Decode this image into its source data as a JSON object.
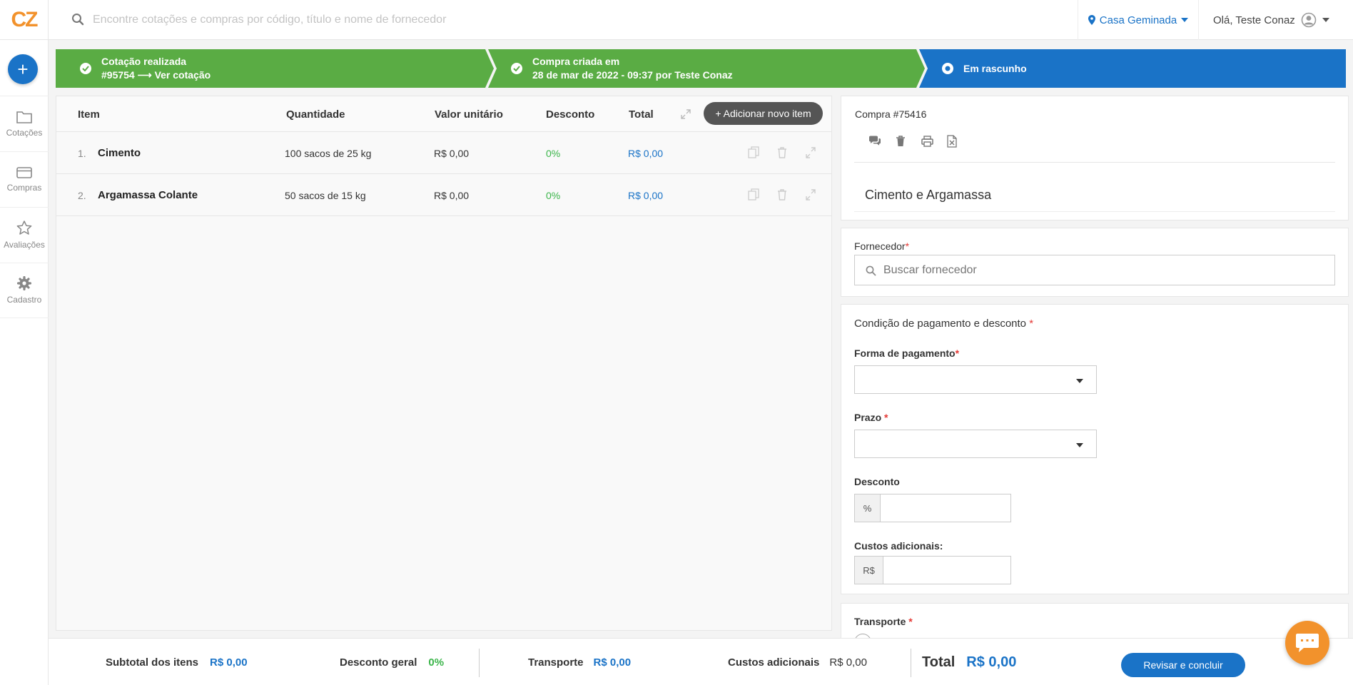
{
  "header": {
    "logo": "CZ",
    "search_placeholder": "Encontre cotações e compras por código, título e nome de fornecedor",
    "location": "Casa Geminada",
    "greeting": "Olá, Teste Conaz"
  },
  "sidebar": {
    "items": [
      {
        "label": "Cotações",
        "icon": "folder-icon"
      },
      {
        "label": "Compras",
        "icon": "card-icon"
      },
      {
        "label": "Avaliações",
        "icon": "star-icon"
      },
      {
        "label": "Cadastro",
        "icon": "gear-icon"
      }
    ]
  },
  "steps": {
    "s1_line1": "Cotação realizada",
    "s1_line2": "#95754 ⟶ Ver cotação",
    "s2_line1": "Compra criada em",
    "s2_line2": "28 de mar de 2022 - 09:37 por Teste Conaz",
    "s3": "Em rascunho"
  },
  "table": {
    "headers": {
      "item": "Item",
      "quantidade": "Quantidade",
      "valor": "Valor unitário",
      "desconto": "Desconto",
      "total": "Total"
    },
    "add_button": "+ Adicionar novo item",
    "rows": [
      {
        "idx": "1.",
        "name": "Cimento",
        "qty": "100 sacos de 25 kg",
        "price": "R$ 0,00",
        "discount": "0%",
        "total": "R$ 0,00"
      },
      {
        "idx": "2.",
        "name": "Argamassa Colante",
        "qty": "50 sacos de 15 kg",
        "price": "R$ 0,00",
        "discount": "0%",
        "total": "R$ 0,00"
      }
    ]
  },
  "purchase": {
    "code": "Compra #75416",
    "title": "Cimento e Argamassa"
  },
  "supplier": {
    "label": "Fornecedor",
    "required": "*",
    "placeholder": "Buscar fornecedor"
  },
  "payment": {
    "section_label": "Condição de pagamento e desconto",
    "required": "*",
    "method_label": "Forma de pagamento",
    "term_label": "Prazo",
    "discount_label": "Desconto",
    "discount_addon": "%",
    "costs_label": "Custos adicionais:",
    "costs_addon": "R$"
  },
  "transport": {
    "label": "Transporte",
    "required": "*"
  },
  "footer": {
    "subtotal_label": "Subtotal dos itens",
    "subtotal_value": "R$ 0,00",
    "discount_label": "Desconto geral",
    "discount_value": "0%",
    "transport_label": "Transporte",
    "transport_value": "R$ 0,00",
    "costs_label": "Custos adicionais",
    "costs_value": "R$ 0,00",
    "total_label": "Total",
    "total_value": "R$ 0,00",
    "review_button": "Revisar e concluir"
  },
  "colors": {
    "accent_blue": "#1a73c7",
    "success_green": "#5aac44",
    "brand_orange": "#f2922c"
  }
}
